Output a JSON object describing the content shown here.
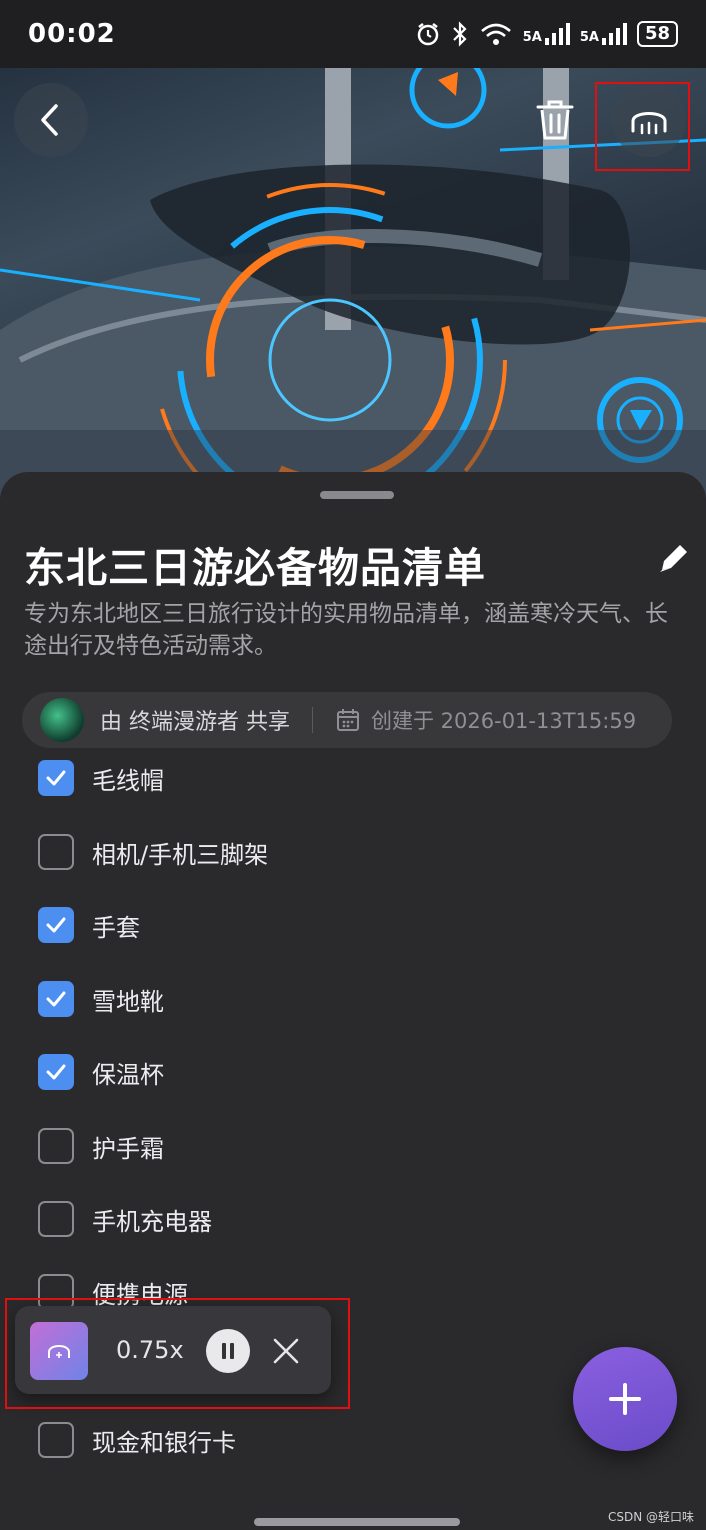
{
  "status": {
    "time": "00:02",
    "icons": [
      "alarm-icon",
      "bluetooth-icon",
      "wifi-icon",
      "signal-5a-icon",
      "signal-5a-icon"
    ],
    "net1": "5A",
    "net2": "5A",
    "battery": "58"
  },
  "header": {
    "back_icon": "chevron-left-icon",
    "delete_icon": "trash-icon",
    "listen_icon": "headphones-icon"
  },
  "checklist": {
    "title": "东北三日游必备物品清单",
    "description": "专为东北地区三日旅行设计的实用物品清单，涵盖寒冷天气、长途出行及特色活动需求。",
    "owner": "由 终端漫游者 共享",
    "created": "创建于 2026-01-13T15:59",
    "items": [
      {
        "label": "毛线帽",
        "checked": true
      },
      {
        "label": "相机/手机三脚架",
        "checked": false
      },
      {
        "label": "手套",
        "checked": true
      },
      {
        "label": "雪地靴",
        "checked": true
      },
      {
        "label": "保温杯",
        "checked": true
      },
      {
        "label": "护手霜",
        "checked": false
      },
      {
        "label": "手机充电器",
        "checked": false
      },
      {
        "label": "便携电源",
        "checked": false
      },
      {
        "label": "现金和银行卡",
        "checked": false
      }
    ]
  },
  "player": {
    "speed": "0.75x"
  },
  "fab": {
    "icon": "plus-icon"
  },
  "watermark": "CSDN @轻口味",
  "colors": {
    "accent": "#4c8ff0",
    "fab": "#7a55d8",
    "highlight": "#e01010"
  }
}
